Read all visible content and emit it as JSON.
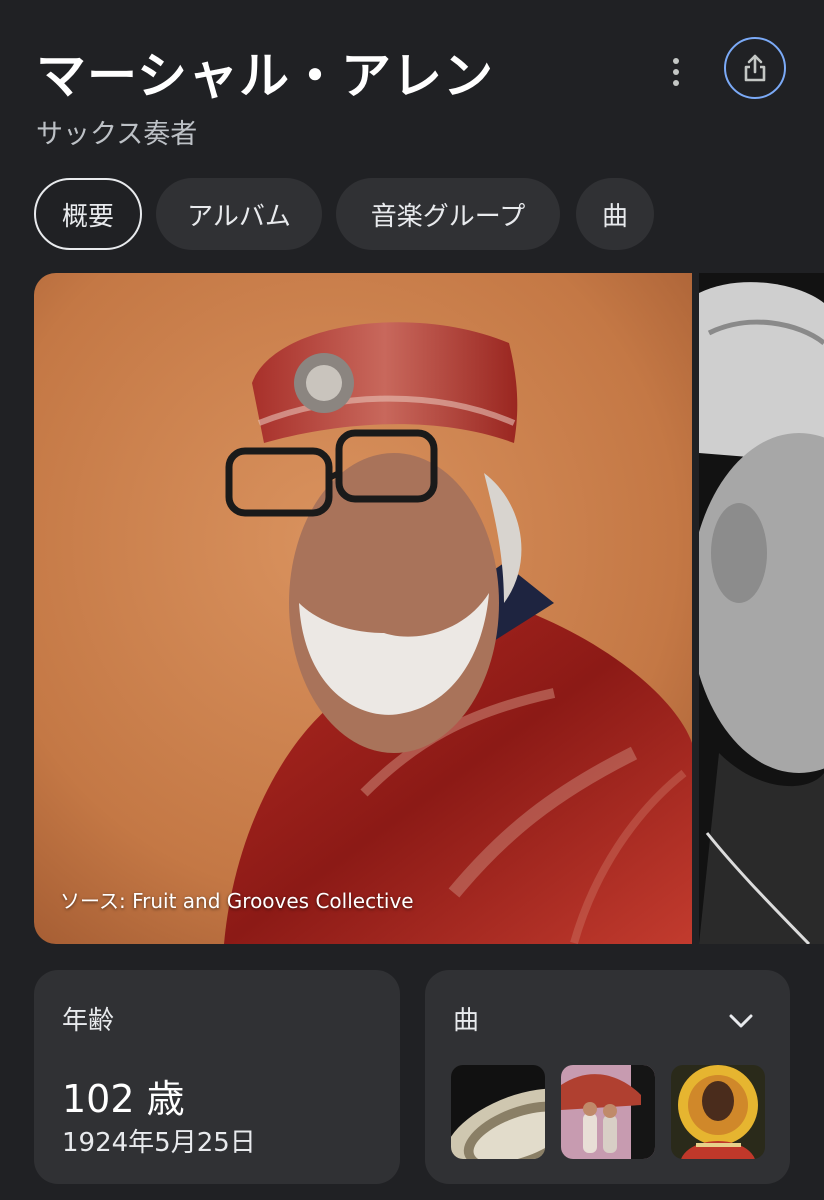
{
  "header": {
    "title": "マーシャル・アレン",
    "subtitle": "サックス奏者"
  },
  "tabs": [
    {
      "label": "概要",
      "active": true
    },
    {
      "label": "アルバム",
      "active": false
    },
    {
      "label": "音楽グループ",
      "active": false
    },
    {
      "label": "曲",
      "active": false
    }
  ],
  "hero": {
    "source": "ソース: Fruit and Grooves Collective"
  },
  "age_card": {
    "label": "年齢",
    "value": "102 歳",
    "birth_date": "1924年5月25日"
  },
  "songs_card": {
    "label": "曲"
  },
  "icons": {
    "more": "more-vert-icon",
    "share": "share-icon",
    "expand": "chevron-down-icon"
  },
  "colors": {
    "background": "#202124",
    "surface": "#303134",
    "accent": "#7baaf7"
  }
}
